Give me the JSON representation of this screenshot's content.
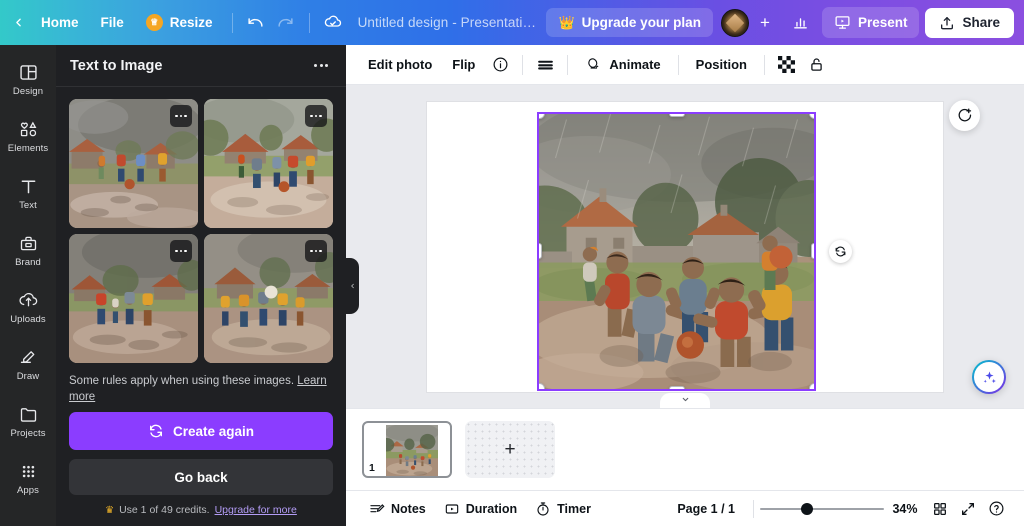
{
  "header": {
    "back_icon": "chevron-left-icon",
    "home_label": "Home",
    "file_label": "File",
    "resize_label": "Resize",
    "resize_icon": "crown-icon",
    "undo_icon": "undo-icon",
    "redo_icon": "redo-icon",
    "cloud_icon": "cloud-saved-icon",
    "title": "Untitled design - Presentation",
    "upgrade_label": "Upgrade your plan",
    "upgrade_icon": "crown-icon",
    "avatar_name": "user-avatar",
    "add_collaborator_icon": "plus-icon",
    "insights_icon": "bar-chart-icon",
    "present_label": "Present",
    "present_icon": "present-screen-icon",
    "share_label": "Share",
    "share_icon": "share-upload-icon",
    "gradient_start": "#33c9c9",
    "gradient_mid": "#2f6fe8",
    "gradient_end": "#8b4fe0"
  },
  "rail": {
    "items": [
      {
        "label": "Design",
        "icon": "layout-design-icon"
      },
      {
        "label": "Elements",
        "icon": "shapes-elements-icon"
      },
      {
        "label": "Text",
        "icon": "text-t-icon"
      },
      {
        "label": "Brand",
        "icon": "brand-kit-icon"
      },
      {
        "label": "Uploads",
        "icon": "upload-cloud-icon"
      },
      {
        "label": "Draw",
        "icon": "draw-pen-icon"
      },
      {
        "label": "Projects",
        "icon": "folder-icon"
      },
      {
        "label": "Apps",
        "icon": "apps-grid-icon"
      }
    ]
  },
  "panel": {
    "title": "Text to Image",
    "more_icon": "more-options-icon",
    "results": [
      {
        "name": "generated-image-1",
        "alt": "Children playing football in rainy village - variant 1"
      },
      {
        "name": "generated-image-2",
        "alt": "Children playing football in rainy village - variant 2"
      },
      {
        "name": "generated-image-3",
        "alt": "Children playing football in rainy village - variant 3"
      },
      {
        "name": "generated-image-4",
        "alt": "Children playing football in rainy village - variant 4"
      }
    ],
    "rules_text": "Some rules apply when using these images.",
    "rules_link": "Learn more",
    "prompt_value": "",
    "prompt_placeholder": "",
    "create_again_label": "Create again",
    "create_again_icon": "refresh-icon",
    "go_back_label": "Go back",
    "credits_icon": "crown-icon",
    "credits_text": "Use 1 of 49 credits.",
    "credits_link": "Upgrade for more",
    "collapse_icon": "chevron-left-icon",
    "accent_color": "#8b3dff"
  },
  "toolbar": {
    "edit_photo_label": "Edit photo",
    "flip_label": "Flip",
    "info_icon": "info-circle-icon",
    "transparency_icon": "transparency-lines-icon",
    "animate_label": "Animate",
    "animate_icon": "animate-circle-icon",
    "position_label": "Position",
    "checker_icon": "transparency-checker-icon",
    "lock_icon": "lock-icon"
  },
  "canvas": {
    "selection_color": "#8b3dff",
    "rotate_icon": "rotate-icon",
    "comment_icon": "add-comment-icon",
    "magic_icon": "magic-sparkles-icon",
    "collapse_chevron_icon": "chevron-down-icon",
    "image_alt": "Watercolor painting of children playing football in a rainy village"
  },
  "pages": {
    "thumbnail_number": "1",
    "add_page_icon": "plus-icon"
  },
  "status": {
    "notes_label": "Notes",
    "notes_icon": "notes-icon",
    "duration_label": "Duration",
    "duration_icon": "duration-play-icon",
    "timer_label": "Timer",
    "timer_icon": "timer-stopwatch-icon",
    "page_indicator": "Page 1 / 1",
    "zoom_percent": "34%",
    "grid_view_icon": "grid-view-icon",
    "fullscreen_icon": "expand-fullscreen-icon",
    "help_icon": "help-circle-icon"
  }
}
